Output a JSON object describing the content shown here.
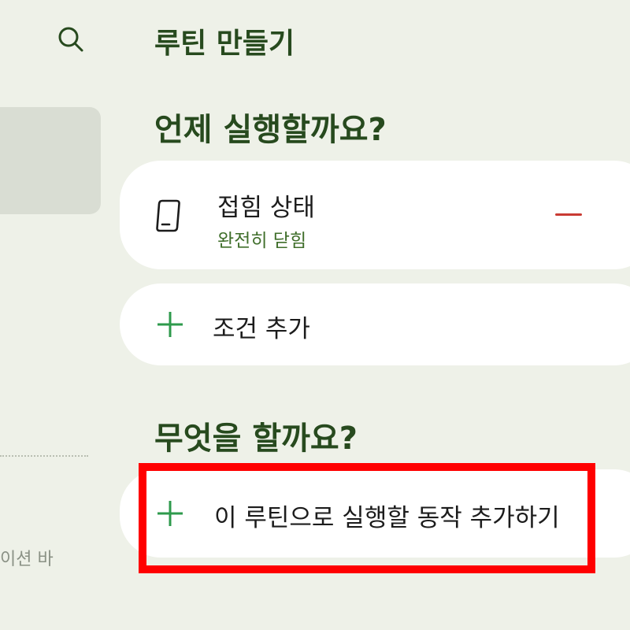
{
  "left_panel": {
    "search_icon": "search-icon",
    "bottom_label": "이션 바"
  },
  "header": {
    "title": "루틴 만들기"
  },
  "when_section": {
    "title": "언제 실행할까요?",
    "condition": {
      "icon": "folded-phone-icon",
      "title": "접힘 상태",
      "subtitle": "완전히 닫힘",
      "remove_icon": "minus-icon"
    },
    "add_condition_label": "조건 추가"
  },
  "what_section": {
    "title": "무엇을 할까요?",
    "add_action_label": "이 루틴으로 실행할 동작 추가하기"
  },
  "colors": {
    "background": "#eef1e8",
    "heading": "#274a1e",
    "accent_green": "#2e9a4c",
    "subtitle_green": "#3f6e2a",
    "remove_red": "#c93b33",
    "highlight_red": "#ff0000"
  }
}
